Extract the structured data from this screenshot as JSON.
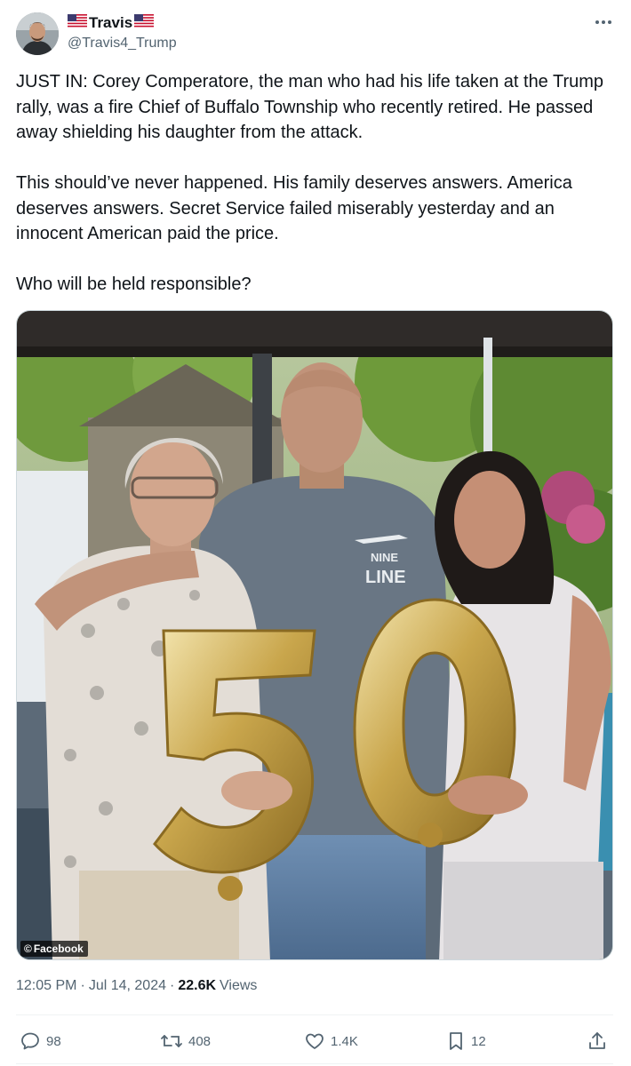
{
  "author": {
    "display_name": "Travis",
    "handle": "@Travis4_Trump",
    "avatar_icon": "avatar-photo",
    "flag_icon": "us-flag-icon"
  },
  "menu": {
    "more_icon": "more-horizontal-icon"
  },
  "tweet": {
    "paragraphs": [
      "JUST IN:  Corey Comperatore, the man who had his life taken at the Trump rally, was a fire Chief of Buffalo Township who recently retired.  He passed away shielding his daughter from the attack.",
      "This should’ve never happened.  His family deserves answers.  America deserves answers.  Secret Service failed miserably yesterday and an innocent American paid the price.",
      "Who will be held responsible?"
    ]
  },
  "media": {
    "watermark": "Facebook",
    "balloon_text": "50",
    "shirt_text_line1": "NINE",
    "shirt_text_line2": "LINE"
  },
  "meta": {
    "time": "12:05 PM",
    "date": "Jul 14, 2024",
    "views_count": "22.6K",
    "views_label": "Views"
  },
  "actions": {
    "replies": "98",
    "reposts": "408",
    "likes": "1.4K",
    "bookmarks": "12"
  },
  "colors": {
    "text": "#0f1419",
    "secondary": "#536471",
    "border": "#eff3f4"
  }
}
